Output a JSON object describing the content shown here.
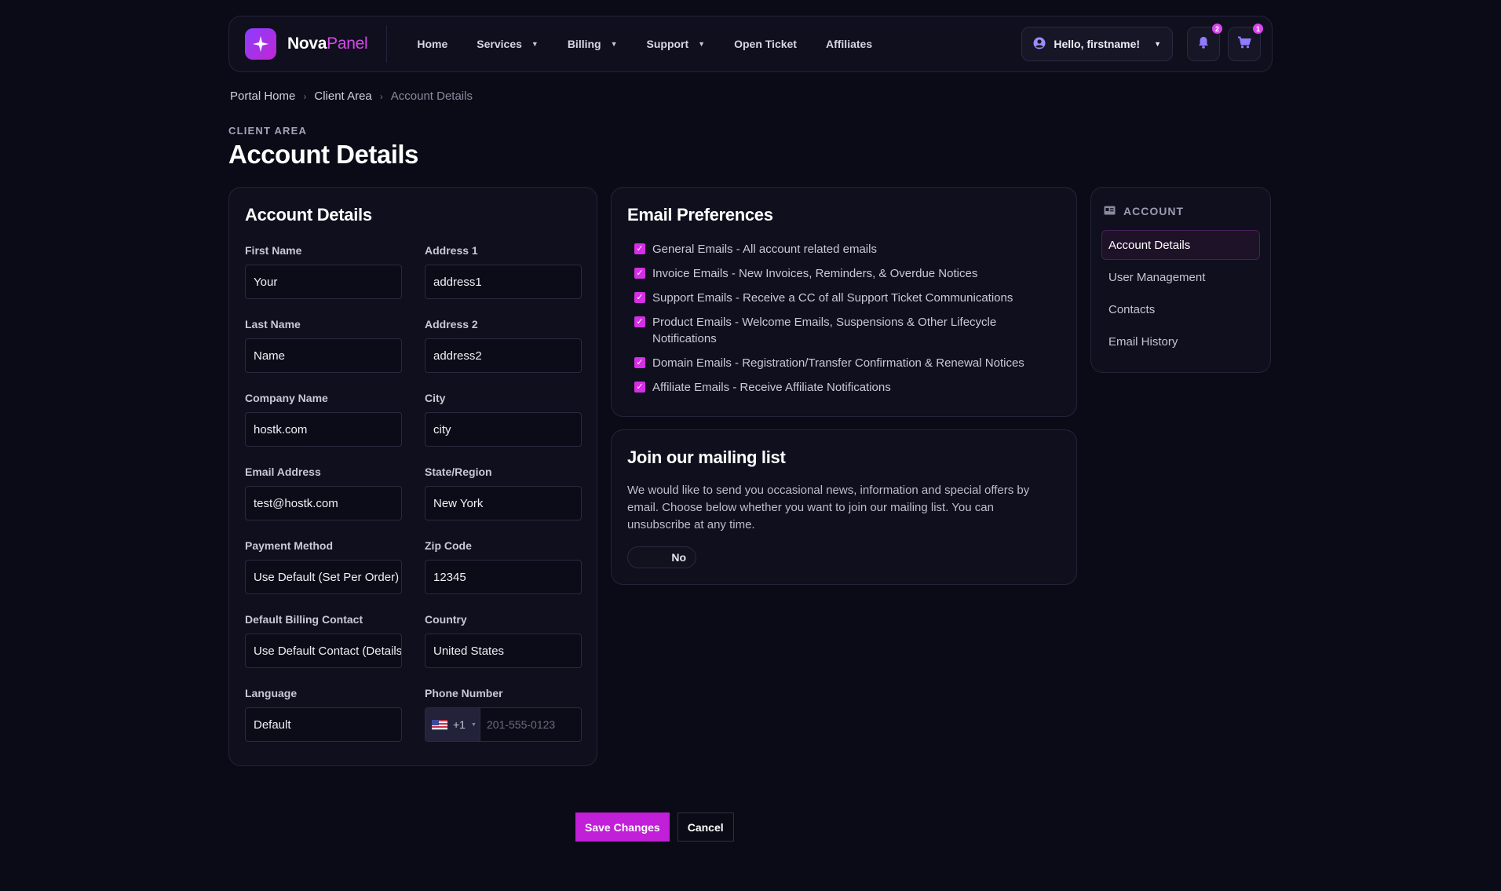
{
  "brand": {
    "part1": "Nova",
    "part2": "Panel",
    "accent": "#d946ef",
    "icon": "sparkle-icon"
  },
  "nav": [
    {
      "label": "Home",
      "dropdown": false
    },
    {
      "label": "Services",
      "dropdown": true
    },
    {
      "label": "Billing",
      "dropdown": true
    },
    {
      "label": "Support",
      "dropdown": true
    },
    {
      "label": "Open Ticket",
      "dropdown": false
    },
    {
      "label": "Affiliates",
      "dropdown": false
    }
  ],
  "user_menu": {
    "label": "Hello, firstname!",
    "icon": "user-circle-icon"
  },
  "notifications": {
    "icon": "bell-icon",
    "count": "2"
  },
  "cart": {
    "icon": "cart-icon",
    "count": "1"
  },
  "breadcrumb": {
    "home": "Portal Home",
    "section": "Client Area",
    "current": "Account Details"
  },
  "page": {
    "eyebrow": "CLIENT AREA",
    "title": "Account Details"
  },
  "account_form": {
    "title": "Account Details",
    "first_name": {
      "label": "First Name",
      "value": "Your"
    },
    "address1": {
      "label": "Address 1",
      "value": "address1"
    },
    "last_name": {
      "label": "Last Name",
      "value": "Name"
    },
    "address2": {
      "label": "Address 2",
      "value": "address2"
    },
    "company": {
      "label": "Company Name",
      "value": "hostk.com"
    },
    "city": {
      "label": "City",
      "value": "city"
    },
    "email": {
      "label": "Email Address",
      "value": "test@hostk.com"
    },
    "state": {
      "label": "State/Region",
      "value": "New York"
    },
    "payment_method": {
      "label": "Payment Method",
      "value": "Use Default (Set Per Order)"
    },
    "zip": {
      "label": "Zip Code",
      "value": "12345"
    },
    "billing_contact": {
      "label": "Default Billing Contact",
      "value": "Use Default Contact (Details Above)"
    },
    "country": {
      "label": "Country",
      "value": "United States"
    },
    "language": {
      "label": "Language",
      "value": "Default"
    },
    "phone": {
      "label": "Phone Number",
      "code": "+1",
      "placeholder": "201-555-0123"
    }
  },
  "email_prefs": {
    "title": "Email Preferences",
    "items": [
      {
        "label": "General Emails - All account related emails",
        "checked": true
      },
      {
        "label": "Invoice Emails - New Invoices, Reminders, & Overdue Notices",
        "checked": true
      },
      {
        "label": "Support Emails - Receive a CC of all Support Ticket Communications",
        "checked": true
      },
      {
        "label": "Product Emails - Welcome Emails, Suspensions & Other Lifecycle Notifications",
        "checked": true
      },
      {
        "label": "Domain Emails - Registration/Transfer Confirmation & Renewal Notices",
        "checked": true
      },
      {
        "label": "Affiliate Emails - Receive Affiliate Notifications",
        "checked": true
      }
    ]
  },
  "mailing_list": {
    "title": "Join our mailing list",
    "text": "We would like to send you occasional news, information and special offers by email. Choose below whether you want to join our mailing list. You can unsubscribe at any time.",
    "toggle_label": "No"
  },
  "sidebar": {
    "heading": "ACCOUNT",
    "icon": "id-card-icon",
    "items": [
      {
        "label": "Account Details",
        "active": true
      },
      {
        "label": "User Management",
        "active": false
      },
      {
        "label": "Contacts",
        "active": false
      },
      {
        "label": "Email History",
        "active": false
      }
    ]
  },
  "actions": {
    "save": "Save Changes",
    "cancel": "Cancel"
  }
}
